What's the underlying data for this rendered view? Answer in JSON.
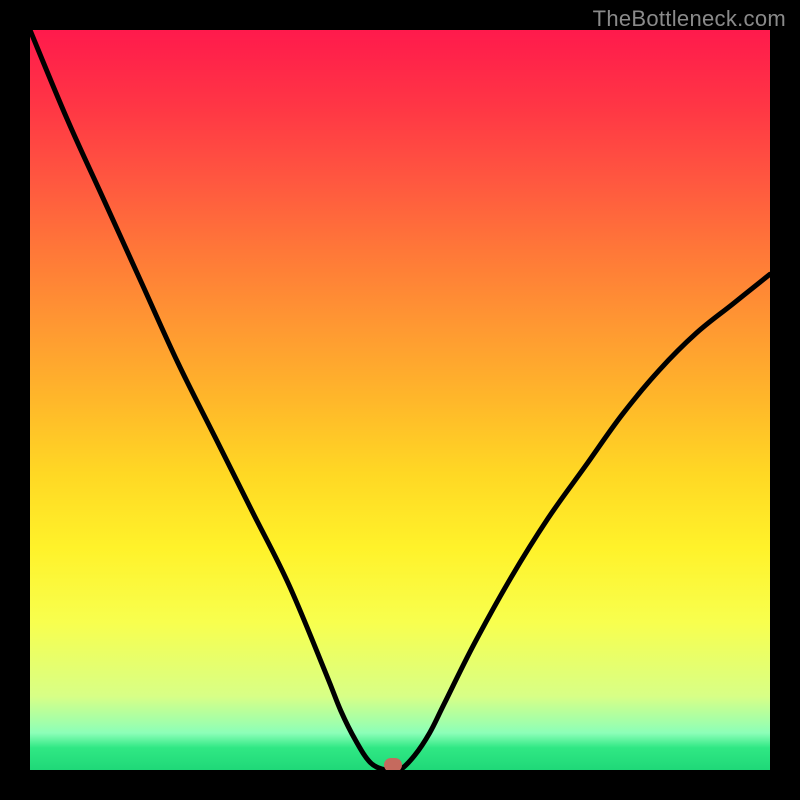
{
  "watermark": "TheBottleneck.com",
  "colors": {
    "frame": "#000000",
    "curve": "#000000",
    "marker": "#c56a5e"
  },
  "chart_data": {
    "type": "line",
    "title": "",
    "xlabel": "",
    "ylabel": "",
    "xlim": [
      0,
      100
    ],
    "ylim": [
      0,
      100
    ],
    "grid": false,
    "legend": false,
    "series": [
      {
        "name": "bottleneck-curve",
        "x": [
          0,
          5,
          10,
          15,
          20,
          25,
          30,
          35,
          40,
          42,
          44,
          46,
          48,
          49,
          50,
          52,
          54,
          56,
          60,
          65,
          70,
          75,
          80,
          85,
          90,
          95,
          100
        ],
        "y": [
          100,
          88,
          77,
          66,
          55,
          45,
          35,
          25,
          13,
          8,
          4,
          1,
          0,
          0,
          0,
          2,
          5,
          9,
          17,
          26,
          34,
          41,
          48,
          54,
          59,
          63,
          67
        ]
      }
    ],
    "annotations": [
      {
        "name": "optimal-marker",
        "x": 49,
        "y": 0
      }
    ],
    "gradient_stops": [
      {
        "pos": 0,
        "color": "#ff1a4c"
      },
      {
        "pos": 50,
        "color": "#ffb72a"
      },
      {
        "pos": 80,
        "color": "#f8ff4e"
      },
      {
        "pos": 100,
        "color": "#1fd878"
      }
    ]
  }
}
